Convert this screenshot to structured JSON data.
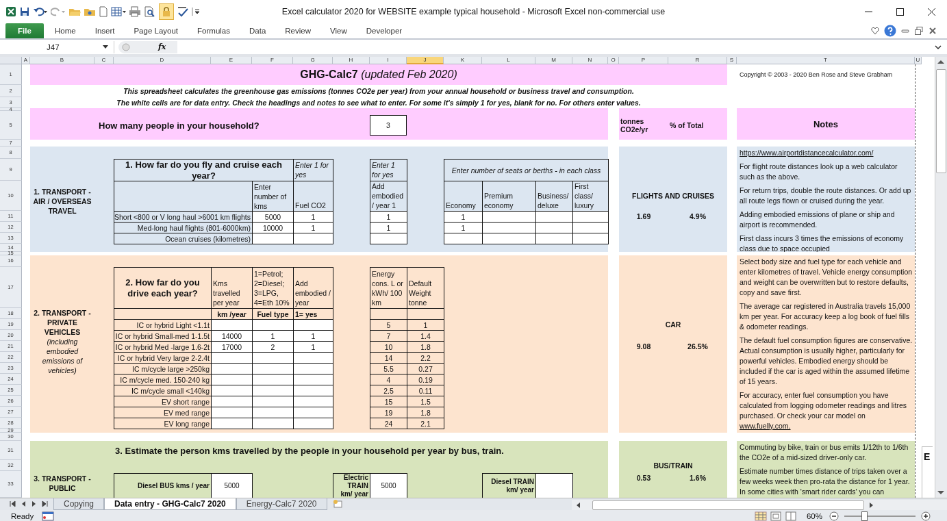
{
  "window": {
    "title": "Excel calculator 2020 for WEBSITE example typical household  -  Microsoft Excel non-commercial use"
  },
  "ribbon": {
    "file_tab": "File",
    "tabs": [
      "Home",
      "Insert",
      "Page Layout",
      "Formulas",
      "Data",
      "Review",
      "View",
      "Developer"
    ]
  },
  "formula_bar": {
    "name_box": "J47",
    "function_label": "fx"
  },
  "column_headers": [
    {
      "label": "A",
      "selected": false
    },
    {
      "label": "B",
      "selected": false
    },
    {
      "label": "C",
      "selected": false
    },
    {
      "label": "D",
      "selected": false
    },
    {
      "label": "E",
      "selected": false
    },
    {
      "label": "F",
      "selected": false
    },
    {
      "label": "G",
      "selected": false
    },
    {
      "label": "H",
      "selected": false
    },
    {
      "label": "I",
      "selected": false
    },
    {
      "label": "J",
      "selected": true
    },
    {
      "label": "K",
      "selected": false
    },
    {
      "label": "L",
      "selected": false
    },
    {
      "label": "M",
      "selected": false
    },
    {
      "label": "N",
      "selected": false
    },
    {
      "label": "O",
      "selected": false
    },
    {
      "label": "P",
      "selected": false
    },
    {
      "label": "R",
      "selected": false
    },
    {
      "label": "S",
      "selected": false
    },
    {
      "label": "T",
      "selected": false
    },
    {
      "label": "U",
      "selected": false
    }
  ],
  "row_headers": [
    "1",
    "2",
    "3",
    "4",
    "5",
    "7",
    "8",
    "9",
    "10",
    "11",
    "12",
    "13",
    "14",
    "15",
    "16",
    "17",
    "18",
    "19",
    "20",
    "21",
    "22",
    "23",
    "24",
    "25",
    "26",
    "27",
    "28",
    "29",
    "30",
    "31",
    "32",
    "33"
  ],
  "sheet": {
    "title": "GHG-Calc7 *(updated Feb 2020)*",
    "copyright": "Copyright © 2003 - 2020  Ben Rose and Steve Grabham",
    "intro": [
      "This spreadsheet calculates the greenhouse gas emissions  (tonnes CO2e per year) from your annual household or business travel and consumption.",
      "The white cells are for data entry. Check the headings and notes to see what to enter.  For some it's simply 1 for yes, blank for no. For others enter values."
    ],
    "household": {
      "question": "How many people in your household?",
      "value": "3"
    },
    "summary_header": {
      "tonnes": "tonnes CO2e/yr",
      "percent": "% of Total"
    },
    "notes_title": "Notes",
    "flights": {
      "section_label": "1. TRANSPORT - AIR / OVERSEAS TRAVEL",
      "question": "1. How far do you fly and cruise each year?",
      "fuel_header": "Enter 1 for yes",
      "kms_header": "Enter number of kms",
      "fuel_subheader": "Fuel CO2",
      "embodied_header": "Enter 1 for yes",
      "embodied_subheader": "Add embodied / year  1",
      "class_header": "Enter number of seats or berths - in each class",
      "classes": [
        "Economy",
        "Premium economy",
        "Business/ deluxe",
        "First class/ luxury"
      ],
      "rows": [
        {
          "label": "Short <800 or V long haul >6001 km flights",
          "kms": "5000",
          "fuel": "1",
          "embodied": "1",
          "seats": [
            "1"
          ]
        },
        {
          "label": "Med-long haul flights (801-6000km)",
          "kms": "10000",
          "fuel": "1",
          "embodied": "1",
          "seats": [
            "1"
          ]
        },
        {
          "label": "Ocean cruises (kilometres)"
        }
      ],
      "summary": {
        "name": "FLIGHTS AND CRUISES",
        "tonnes": "1.69",
        "percent": "4.9%"
      },
      "notes": [
        {
          "kind": "link",
          "text": "https://www.airportdistancecalculator.com/"
        },
        {
          "kind": "text",
          "text": "For flight route distances look up a web calculator such as the above."
        },
        {
          "kind": "text",
          "text": "For return trips, double the route distances.  Or add up all route legs flown or cruised during the year."
        },
        {
          "kind": "text",
          "text": "Adding embodied emissions of plane or ship and airport is recommended."
        },
        {
          "kind": "text",
          "text": "First class incurs 3 times the emissions of economy class due to space occupied"
        }
      ]
    },
    "car": {
      "section_label": "2. TRANSPORT - PRIVATE VEHICLES",
      "section_note": "(including embodied emissions of vehicles)",
      "question": "2. How far do you drive each year?",
      "headers": [
        "Kms travelled per year",
        "1=Petrol; 2=Diesel; 3=LPG, 4=Eth 10%",
        "Add embodied / year"
      ],
      "subheaders": [
        "km /year",
        "Fuel type",
        "1= yes"
      ],
      "energy_header": "Energy cons.  L or kWh/ 100 km",
      "weight_header": "Default Weight tonne",
      "rows": [
        {
          "label": "IC or hybrid Light <1.1t",
          "energy": "5",
          "weight": "1"
        },
        {
          "label": "IC or hybrid Small-med 1-1.5t",
          "kms": "14000",
          "fuel": "1",
          "embodied": "1",
          "energy": "7",
          "weight": "1.4"
        },
        {
          "label": "IC or hybrid Med -large  1.6-2t",
          "kms": "17000",
          "fuel": "2",
          "embodied": "1",
          "energy": "10",
          "weight": "1.8"
        },
        {
          "label": "IC or hybrid Very large 2-2.4t",
          "energy": "14",
          "weight": "2.2"
        },
        {
          "label": "IC  m/cycle large >250kg",
          "energy": "5.5",
          "weight": "0.27"
        },
        {
          "label": "IC m/cycle med. 150-240 kg",
          "energy": "4",
          "weight": "0.19"
        },
        {
          "label": "IC m/cycle small <140kg",
          "energy": "2.5",
          "weight": "0.11"
        },
        {
          "label": "EV short range",
          "energy": "15",
          "weight": "1.5"
        },
        {
          "label": "EV med range",
          "energy": "19",
          "weight": "1.8"
        },
        {
          "label": "EV long range",
          "energy": "24",
          "weight": "2.1"
        }
      ],
      "summary": {
        "name": "CAR",
        "tonnes": "9.08",
        "percent": "26.5%"
      },
      "notes": [
        {
          "kind": "text",
          "text": "Select body size and fuel type for each vehicle and enter kilometres of travel. Vehicle energy consumption and weight can be overwritten but  to restore defaults, copy and save first."
        },
        {
          "kind": "text",
          "text": "The average car registered in Australia travels 15,000 km per year. For accuracy keep a log book of fuel fills & odometer readings."
        },
        {
          "kind": "text",
          "text": "The default fuel consumption figures are conservative. Actual consumption is usually higher, particularly for powerful vehicles. Embodied energy should be included if the car is aged within the assumed lifetime of 15 years."
        },
        {
          "kind": "text",
          "text": "For accuracy, enter fuel consumption you have calculated from logging odometer readings and litres purchased. Or check your car model on",
          "link": "www.fuelly.com."
        }
      ]
    },
    "public": {
      "header": "3. Estimate the person kms travelled by the people in your household per year by bus, train.",
      "section_label": "3. TRANSPORT - PUBLIC",
      "entries": [
        {
          "label": "Diesel BUS kms / year",
          "value": "5000"
        },
        {
          "label": "Electric TRAIN km/ year",
          "value": "5000"
        },
        {
          "label": "Diesel TRAIN km/ year"
        }
      ],
      "summary": {
        "name": "BUS/TRAIN",
        "tonnes": "0.53",
        "percent": "1.6%"
      },
      "notes": [
        {
          "kind": "text",
          "text": "Commuting by bike, train or bus emits 1/12th to 1/6th the CO2e of a mid-sized driver-only car."
        },
        {
          "kind": "text",
          "text": "Estimate number times distance of trips taken over a few weeks week then pro-rata the distance for 1 year. In some cities with 'smart rider cards' you can"
        }
      ]
    },
    "next_column_text": "E"
  },
  "sheet_tabs": [
    {
      "label": "Copying",
      "selected": false
    },
    {
      "label": "Data entry - GHG-Calc7 2020",
      "selected": true
    },
    {
      "label": "Energy-Calc7 2020",
      "selected": false
    }
  ],
  "status_bar": {
    "status": "Ready",
    "zoom": "60%",
    "zoom_slider": {
      "level": 0.28
    }
  }
}
